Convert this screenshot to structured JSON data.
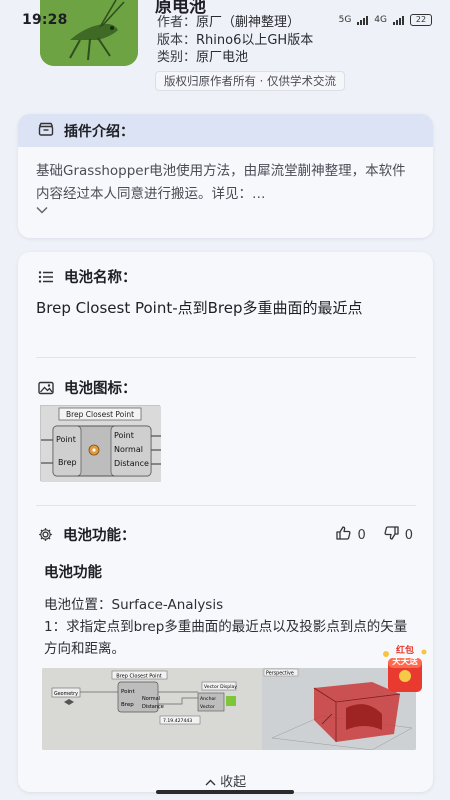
{
  "status_bar": {
    "time": "19:28",
    "network": "5G",
    "network2": "4G",
    "battery": "22"
  },
  "plugin": {
    "name": "原电池",
    "author_key": "作者：",
    "author_value": "原厂（蒯神整理）",
    "version_key": "版本：",
    "version_value": "Rhino6以上GH版本",
    "category_key": "类别：",
    "category_value": "原厂电池",
    "copyright": "版权归原作者所有 · 仅供学术交流"
  },
  "intro": {
    "title": "插件介绍：",
    "text": "基础Grasshopper电池使用方法，由犀流堂蒯神整理，本软件内容经过本人同意进行搬运。详见：…"
  },
  "detail": {
    "name_label": "电池名称：",
    "name_value": "Brep Closest Point-点到Brep多重曲面的最近点",
    "icon_label": "电池图标：",
    "thumb": {
      "title": "Brep Closest Point",
      "input_point": "Point",
      "input_brep": "Brep",
      "output_point": "Point",
      "output_normal": "Normal",
      "output_distance": "Distance"
    },
    "function_label": "电池功能：",
    "likes": "0",
    "dislikes": "0",
    "function_title": "电池功能",
    "location": "电池位置：Surface-Analysis",
    "description": "1：求指定点到brep多重曲面的最近点以及投影点到点的矢量方向和距离。",
    "image": {
      "perspective_label": "Perspective",
      "node_title": "Brep Closest Point",
      "node_point": "Point",
      "node_brep": "Brep",
      "node_normal": "Normal",
      "node_distance": "Distance",
      "anchor_label": "Anchor",
      "vector_label": "Vector",
      "vector_display": "Vector Display",
      "geometry_label": "Geometry",
      "value_label": "7.19.427443"
    },
    "collapse_label": "收起"
  },
  "redpacket": {
    "line1": "红包",
    "line2": "天天送"
  },
  "colors": {
    "accent_header": "#dbe3f5",
    "app_icon_green": "#6ea344",
    "page_bg": "#eef1f7",
    "redpacket_red": "#e83a2f"
  }
}
